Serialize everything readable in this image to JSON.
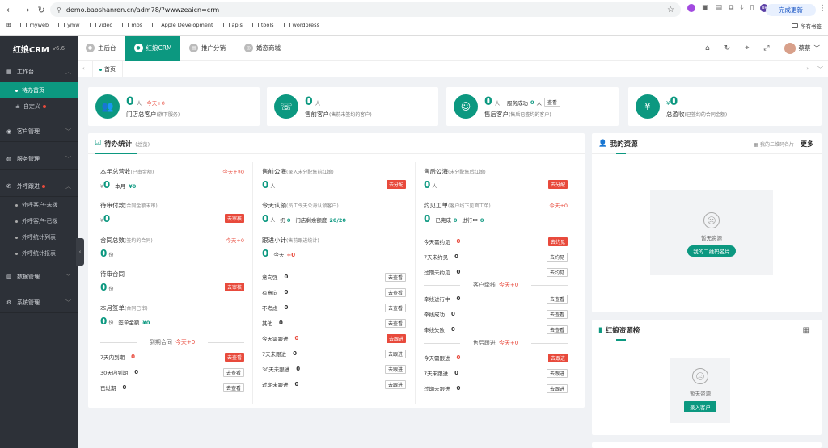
{
  "browser": {
    "url": "demo.baoshanren.cn/adm78/?wwwzeaicn=crm",
    "update_label": "完成更新",
    "bookmarks": [
      "myweb",
      "ymw",
      "video",
      "mbs",
      "Apple Development",
      "apis",
      "tools",
      "wordpress"
    ],
    "all_bookmarks": "所有书签",
    "ext_avatar": "BR"
  },
  "sidebar": {
    "logo": "红娘CRM",
    "version": "v6.6",
    "groups": [
      {
        "label": "工作台",
        "items": [
          "待办首页",
          "自定义"
        ]
      },
      {
        "label": "客户管理"
      },
      {
        "label": "服务管理"
      },
      {
        "label": "外呼跟进",
        "items": [
          "外呼客户-未拨",
          "外呼客户-已拨",
          "外呼统计列表",
          "外呼统计报表"
        ]
      },
      {
        "label": "数据管理"
      },
      {
        "label": "系统管理"
      }
    ]
  },
  "topnav": {
    "tabs": [
      "主后台",
      "红娘CRM",
      "推广分销",
      "婚恋商城"
    ],
    "user": "蔡蔡"
  },
  "tabstrip": {
    "home": "首页"
  },
  "stats": [
    {
      "num": "0",
      "unit": "人",
      "plus": "今天+0",
      "label": "门店总客户",
      "sub": "(旗下服务)"
    },
    {
      "num": "0",
      "unit": "人",
      "label": "售前客户",
      "sub": "(售前未签约的客户)"
    },
    {
      "num": "0",
      "unit": "人",
      "label": "售后客户",
      "sub": "(售后已签约的客户)",
      "extra": "服务成功",
      "extra_num": "0",
      "extra_unit": "人",
      "btn": "查看"
    },
    {
      "num": "0",
      "prefix": "¥",
      "label": "总盈收",
      "sub": "(已签约的合同金额)"
    }
  ],
  "todo": {
    "title": "待办统计",
    "sub": "(总览)",
    "col1": {
      "total_title": "本年总营收",
      "total_sub": "(已审金额)",
      "total_plus": "今天+¥0",
      "total_prefix": "¥",
      "total_num": "0",
      "month_label": "本月",
      "month_val": "¥0",
      "pending_pay_title": "待审付款",
      "pending_pay_sub": "(合同金额未审)",
      "pending_pay_prefix": "¥",
      "pending_pay_num": "0",
      "pending_pay_btn": "去审核",
      "contracts_title": "合同总数",
      "contracts_sub": "(签约的合同)",
      "contracts_plus": "今天+0",
      "contracts_num": "0",
      "contracts_unit": "份",
      "review_title": "待审合同",
      "review_num": "0",
      "review_unit": "份",
      "review_btn": "去审核",
      "month_sign_title": "本月签单",
      "month_sign_sub": "(合同已审)",
      "month_sign_num": "0",
      "month_sign_unit": "份",
      "sign_amount_label": "签单金额",
      "sign_amount": "¥0",
      "expire_title": "到期合同",
      "expire_plus": "今天+0",
      "expire_rows": [
        {
          "label": "7天内到期",
          "val": "0",
          "btn": "去查看",
          "red": true
        },
        {
          "label": "30天内到期",
          "val": "0",
          "btn": "去查看"
        },
        {
          "label": "已过期",
          "val": "0",
          "btn": "去查看"
        }
      ]
    },
    "col2": {
      "pre_sea_title": "售前公海",
      "pre_sea_sub": "(录入未分配售前红娘)",
      "pre_sea_num": "0",
      "pre_sea_unit": "人",
      "pre_sea_btn": "去分配",
      "claim_title": "今天认领",
      "claim_sub": "(员工今天公海认领客户)",
      "claim_num": "0",
      "claim_unit": "人",
      "claim_extra": "扔",
      "claim_extra_num": "0",
      "quota_label": "门店剩余额度",
      "quota_val": "20/20",
      "follow_title": "跟进小计",
      "follow_sub": "(售前跟进统计)",
      "follow_num": "0",
      "follow_today": "今天",
      "follow_plus": "+0",
      "rows": [
        {
          "label": "意向强",
          "val": "0",
          "btn": "去查看"
        },
        {
          "label": "有意向",
          "val": "0",
          "btn": "去查看"
        },
        {
          "label": "不考虑",
          "val": "0",
          "btn": "去查看"
        },
        {
          "label": "其他",
          "val": "0",
          "btn": "去查看"
        },
        {
          "label": "今天需跟进",
          "val": "0",
          "btn": "去跟进",
          "red": true
        },
        {
          "label": "7天未跟进",
          "val": "0",
          "btn": "去跟进"
        },
        {
          "label": "30天未跟进",
          "val": "0",
          "btn": "去跟进"
        },
        {
          "label": "过期未跟进",
          "val": "0",
          "btn": "去跟进"
        }
      ]
    },
    "col3": {
      "post_sea_title": "售后公海",
      "post_sea_sub": "(未分配售后红娘)",
      "post_sea_num": "0",
      "post_sea_unit": "人",
      "post_sea_btn": "去分配",
      "meet_title": "约见工单",
      "meet_sub": "(客户线下见面工单)",
      "meet_plus": "今天+0",
      "meet_num": "0",
      "done_label": "已完成",
      "done_val": "0",
      "ongoing_label": "进行中",
      "ongoing_val": "0",
      "meet_rows": [
        {
          "label": "今天需约见",
          "val": "0",
          "btn": "去约见",
          "red": true
        },
        {
          "label": "7天未约见",
          "val": "0",
          "btn": "去约见"
        },
        {
          "label": "过期未约见",
          "val": "0",
          "btn": "去约见"
        }
      ],
      "match_title": "客户牵线",
      "match_plus": "今天+0",
      "match_rows": [
        {
          "label": "牵线进行中",
          "val": "0",
          "btn": "去查看"
        },
        {
          "label": "牵线成功",
          "val": "0",
          "btn": "去查看"
        },
        {
          "label": "牵线失败",
          "val": "0",
          "btn": "去查看"
        }
      ],
      "after_title": "售后跟进",
      "after_plus": "今天+0",
      "after_rows": [
        {
          "label": "今天需跟进",
          "val": "0",
          "btn": "去跟进",
          "red": true
        },
        {
          "label": "7天未跟进",
          "val": "0",
          "btn": "去跟进"
        },
        {
          "label": "过期未跟进",
          "val": "0",
          "btn": "去跟进"
        }
      ]
    }
  },
  "resources": {
    "title": "我的资源",
    "qr_label": "我的二维码名片",
    "more": "更多",
    "empty": "暂无资源",
    "btn": "我的二维码名片"
  },
  "rank": {
    "title": "红娘资源榜",
    "empty": "暂无资源",
    "btn": "录入客户"
  },
  "colors": {
    "accent": "#0c9880",
    "danger": "#e84a3c",
    "sidebar": "#2d3138"
  }
}
